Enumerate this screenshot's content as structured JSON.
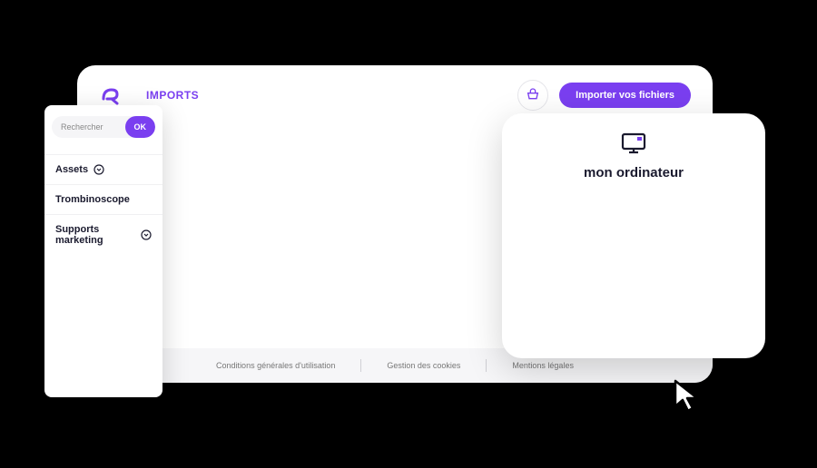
{
  "header": {
    "page_title": "IMPORTS",
    "import_button_label": "Importer vos fichiers"
  },
  "sidebar": {
    "search_placeholder": "Rechercher",
    "search_ok_label": "OK",
    "items": [
      {
        "label": "Assets",
        "has_chevron": true
      },
      {
        "label": "Trombinoscope",
        "has_chevron": false
      },
      {
        "label": "Supports marketing",
        "has_chevron": true
      }
    ]
  },
  "footer": {
    "links": [
      "Conditions générales d'utilisation",
      "Gestion des cookies",
      "Mentions légales"
    ]
  },
  "popup": {
    "title": "mon ordinateur"
  },
  "colors": {
    "accent": "#7a3ff0"
  }
}
